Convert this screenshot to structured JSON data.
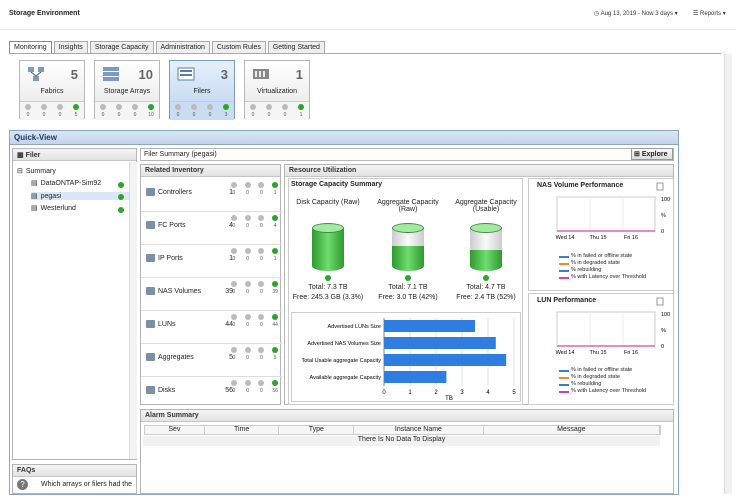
{
  "header": {
    "title": "Storage Environment",
    "date_range": "Aug 13, 2019 - Now 3 days",
    "reports": "Reports"
  },
  "tabs": [
    "Monitoring",
    "Insights",
    "Storage Capacity",
    "Administration",
    "Custom Rules",
    "Getting Started"
  ],
  "tiles": [
    {
      "label": "Fabrics",
      "count": "5",
      "stats": [
        "0",
        "0",
        "0",
        "5"
      ]
    },
    {
      "label": "Storage Arrays",
      "count": "10",
      "stats": [
        "0",
        "0",
        "0",
        "10"
      ]
    },
    {
      "label": "Filers",
      "count": "3",
      "stats": [
        "0",
        "0",
        "0",
        "3"
      ]
    },
    {
      "label": "Virtualization",
      "count": "1",
      "stats": [
        "0",
        "0",
        "0",
        "1"
      ]
    }
  ],
  "quickview": {
    "title": "Quick-View"
  },
  "nav": {
    "title": "Filer",
    "root": "Summary",
    "items": [
      "DataONTAP-Sim92",
      "pegasi",
      "Westerlund"
    ]
  },
  "faqs": {
    "title": "FAQs",
    "question": "Which arrays or filers had the"
  },
  "summary": {
    "title": "Filer Summary (pegasi)",
    "explore": "Explore"
  },
  "related": {
    "title": "Related Inventory",
    "rows": [
      {
        "name": "Controllers",
        "count": "1",
        "stats": [
          "0",
          "0",
          "0",
          "1"
        ]
      },
      {
        "name": "FC Ports",
        "count": "4",
        "stats": [
          "0",
          "0",
          "0",
          "4"
        ]
      },
      {
        "name": "IP Ports",
        "count": "1",
        "stats": [
          "0",
          "0",
          "0",
          "1"
        ]
      },
      {
        "name": "NAS Volumes",
        "count": "39",
        "stats": [
          "0",
          "0",
          "0",
          "39"
        ]
      },
      {
        "name": "LUNs",
        "count": "44",
        "stats": [
          "0",
          "0",
          "0",
          "44"
        ]
      },
      {
        "name": "Aggregates",
        "count": "5",
        "stats": [
          "0",
          "0",
          "0",
          "5"
        ]
      },
      {
        "name": "Disks",
        "count": "56",
        "stats": [
          "0",
          "0",
          "0",
          "56"
        ]
      }
    ]
  },
  "resource": {
    "title": "Resource Utilization",
    "scs_title": "Storage Capacity Summary",
    "cylinders": [
      {
        "title": "Disk Capacity (Raw)",
        "total": "Total: 7.3 TB",
        "free": "Free: 245.3 GB (3.3%)",
        "used_fraction": 0.967
      },
      {
        "title": "Aggregate Capacity (Raw)",
        "total": "Total: 7.1 TB",
        "free": "Free: 3.0 TB (42%)",
        "used_fraction": 0.58
      },
      {
        "title": "Aggregate Capacity (Usable)",
        "total": "Total: 4.7 TB",
        "free": "Free: 2.4 TB (52%)",
        "used_fraction": 0.48
      }
    ]
  },
  "chart_data": {
    "type": "bar",
    "categories": [
      "Advertised LUNs Size",
      "Advertised NAS Volumes Size",
      "Total Usable aggregate Capacity",
      "Available aggregate Capacity"
    ],
    "values": [
      3.5,
      4.3,
      4.7,
      2.4
    ],
    "xlabel": "TB",
    "xlim": [
      0,
      5
    ],
    "ticks": [
      "0",
      "1",
      "2",
      "3",
      "4",
      "5"
    ],
    "color": "#2f7de0"
  },
  "perf": {
    "nas_title": "NAS Volume Performance",
    "lun_title": "LUN Performance",
    "x_ticks": [
      "Wed 14",
      "Thu 15",
      "Fri 16"
    ],
    "y_ticks": [
      "100",
      "%",
      "0"
    ],
    "legend": [
      {
        "label": "% in failed or offline state",
        "color": "#3a7bd5"
      },
      {
        "label": "% in degraded state",
        "color": "#f08a24"
      },
      {
        "label": "% rebuilding",
        "color": "#3a7bd5"
      },
      {
        "label": "% with Latency over Threshold",
        "color": "#e0409e"
      }
    ]
  },
  "alarm": {
    "title": "Alarm Summary",
    "columns": [
      "Sev",
      "Time",
      "Type",
      "Instance Name",
      "Message"
    ],
    "empty": "There Is No Data To Display"
  }
}
